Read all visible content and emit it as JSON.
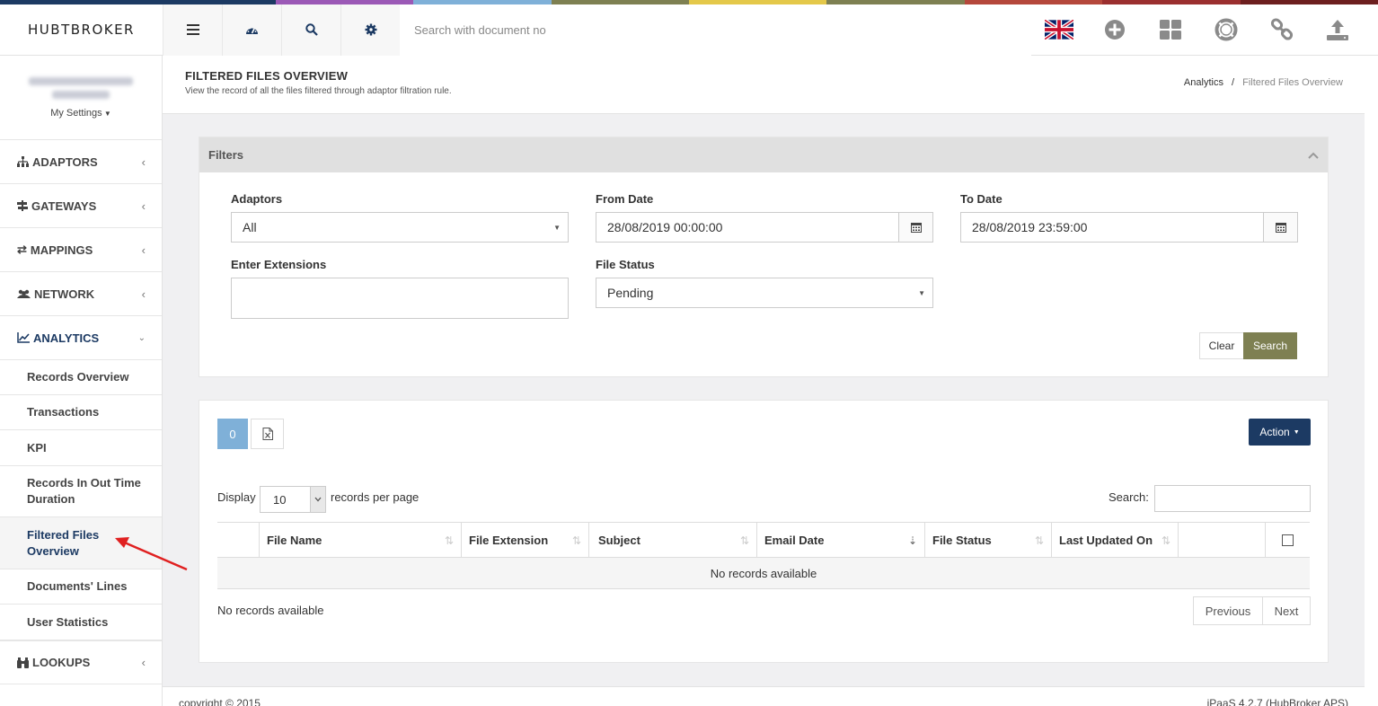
{
  "stripe_colors": [
    "#1c3a63",
    "#1c3a63",
    "#9b59b6",
    "#7fb0d8",
    "#7e8052",
    "#e4c84a",
    "#7e8052",
    "#b5483c",
    "#9b2f2f",
    "#6d1f1f"
  ],
  "header": {
    "logo": "HUBTBROKER",
    "search_placeholder": "Search with document no"
  },
  "user": {
    "my_settings": "My Settings"
  },
  "sidebar": {
    "sections": [
      {
        "label": "ADAPTORS"
      },
      {
        "label": "GATEWAYS"
      },
      {
        "label": "MAPPINGS"
      },
      {
        "label": "NETWORK"
      },
      {
        "label": "ANALYTICS"
      }
    ],
    "analytics_items": [
      {
        "label": "Records Overview"
      },
      {
        "label": "Transactions"
      },
      {
        "label": "KPI"
      },
      {
        "label": "Records In Out Time Duration"
      },
      {
        "label": "Filtered Files Overview"
      },
      {
        "label": "Documents' Lines"
      },
      {
        "label": "User Statistics"
      }
    ],
    "lookups": "LOOKUPS"
  },
  "page": {
    "title": "FILTERED FILES OVERVIEW",
    "subtitle": "View the record of all the files filtered through adaptor filtration rule.",
    "breadcrumb_parent": "Analytics",
    "breadcrumb_sep": "/",
    "breadcrumb_current": "Filtered Files Overview"
  },
  "filters": {
    "heading": "Filters",
    "adaptors_label": "Adaptors",
    "adaptors_value": "All",
    "from_date_label": "From Date",
    "from_date_value": "28/08/2019 00:00:00",
    "to_date_label": "To Date",
    "to_date_value": "28/08/2019 23:59:00",
    "extensions_label": "Enter Extensions",
    "extensions_value": "",
    "file_status_label": "File Status",
    "file_status_value": "Pending",
    "clear_label": "Clear",
    "search_label": "Search"
  },
  "results": {
    "count": "0",
    "action_label": "Action",
    "display_label": "Display",
    "page_size": "10",
    "per_page_label": "records per page",
    "search_label": "Search:",
    "columns": [
      "File Name",
      "File Extension",
      "Subject",
      "Email Date",
      "File Status",
      "Last Updated On"
    ],
    "empty_row": "No records available",
    "info": "No records available",
    "prev_label": "Previous",
    "next_label": "Next"
  },
  "footer": {
    "copyright": "copyright © 2015",
    "version": "iPaaS 4.2.7 (HubBroker APS)"
  },
  "colors": {
    "accent_navy": "#1c3a63",
    "search_olive": "#7e8052",
    "count_blue": "#7fb0d8",
    "annotation_red": "#e02020"
  }
}
